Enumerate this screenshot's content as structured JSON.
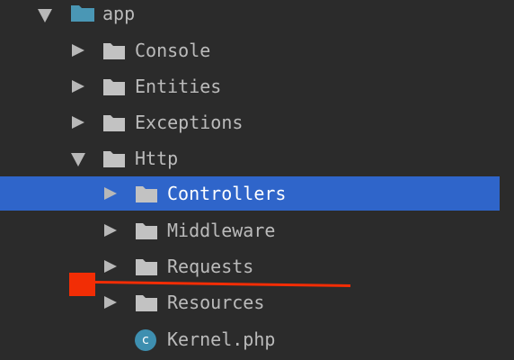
{
  "project_tree": {
    "root": {
      "label": "app",
      "expanded": true,
      "icon": "blue-folder-icon"
    },
    "app_children": [
      {
        "label": "Console",
        "expanded": false
      },
      {
        "label": "Entities",
        "expanded": false
      },
      {
        "label": "Exceptions",
        "expanded": false
      },
      {
        "label": "Http",
        "expanded": true
      }
    ],
    "http_children": [
      {
        "label": "Controllers",
        "expanded": false,
        "selected": true
      },
      {
        "label": "Middleware",
        "expanded": false
      },
      {
        "label": "Requests",
        "expanded": false
      },
      {
        "label": "Resources",
        "expanded": false
      }
    ],
    "file": {
      "label": "Kernel.php",
      "icon_letter": "c"
    }
  },
  "colors": {
    "background": "#2b2b2b",
    "selection": "#2f65ca",
    "annotation": "#f22d05",
    "app_folder": "#4a97b5",
    "folder": "#c2c2c2"
  }
}
